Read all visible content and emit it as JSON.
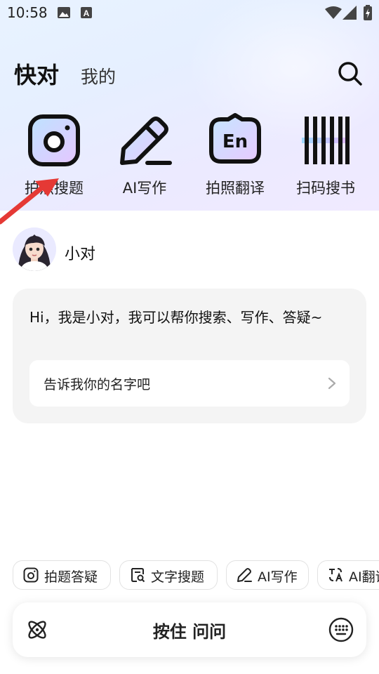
{
  "status_bar": {
    "time": "10:58",
    "icons": [
      "image-icon",
      "a-box-icon",
      "wifi-icon",
      "signal-icon",
      "battery-icon"
    ]
  },
  "header": {
    "tab_active": "快对",
    "tab_mine": "我的",
    "search_icon": "search-icon"
  },
  "features": [
    {
      "label": "拍照搜题",
      "icon": "camera-icon"
    },
    {
      "label": "AI写作",
      "icon": "pencil-icon"
    },
    {
      "label": "拍照翻译",
      "icon": "en-translate-icon"
    },
    {
      "label": "扫码搜书",
      "icon": "barcode-icon"
    }
  ],
  "chat": {
    "bot_name": "小对",
    "greeting": "Hi，我是小对，我可以帮你搜索、写作、答疑~",
    "suggestion": "告诉我你的名字吧"
  },
  "chips": [
    {
      "label": "拍题答疑",
      "icon": "camera-icon"
    },
    {
      "label": "文字搜题",
      "icon": "text-search-icon"
    },
    {
      "label": "AI写作",
      "icon": "pencil-icon"
    },
    {
      "label": "AI翻译",
      "icon": "translate-icon"
    }
  ],
  "bottom_bar": {
    "hold_to_ask": "按住 问问",
    "left_icon": "atom-icon",
    "right_icon": "keyboard-icon"
  },
  "colors": {
    "annotation_arrow": "#e53935",
    "accent_gradient_start": "#e8f3ff",
    "accent_gradient_end": "#f0eaff"
  }
}
